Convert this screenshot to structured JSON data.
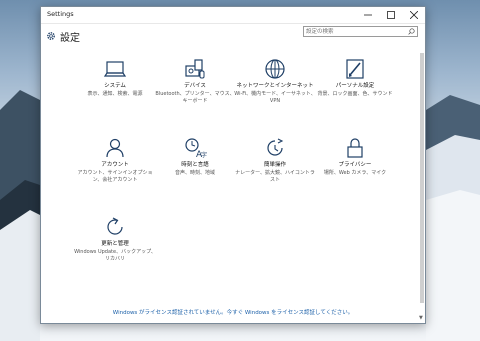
{
  "window": {
    "title": "Settings"
  },
  "header": {
    "title": "設定"
  },
  "search": {
    "placeholder": "設定の検索"
  },
  "tiles": [
    {
      "name": "システム",
      "desc": "表示、通知、検索、電源",
      "icon": "laptop-icon"
    },
    {
      "name": "デバイス",
      "desc": "Bluetooth、プリンター、マウス、キーボード",
      "icon": "devices-icon"
    },
    {
      "name": "ネットワークとインターネット",
      "desc": "Wi-Fi、機内モード、イーサネット、VPN",
      "icon": "globe-icon"
    },
    {
      "name": "パーソナル設定",
      "desc": "背景、ロック画面、色、サウンド",
      "icon": "personalization-icon"
    },
    {
      "name": "アカウント",
      "desc": "アカウント、サインインオプション、会社アカウント",
      "icon": "person-icon"
    },
    {
      "name": "時刻と言語",
      "desc": "音声、時刻、地域",
      "icon": "time-language-icon"
    },
    {
      "name": "簡単操作",
      "desc": "ナレーター、拡大鏡、ハイコントラスト",
      "icon": "ease-of-access-icon"
    },
    {
      "name": "プライバシー",
      "desc": "場所、Web カメラ、マイク",
      "icon": "lock-icon"
    },
    {
      "name": "更新と管理",
      "desc": "Windows Update、バックアップ、リカバリ",
      "icon": "refresh-icon"
    }
  ],
  "footer": {
    "message": "Windows がライセンス認証されていません。今すぐ Windows をライセンス認証してください。"
  },
  "colors": {
    "accent": "#1a5fa8",
    "icon": "#1f3f66"
  }
}
